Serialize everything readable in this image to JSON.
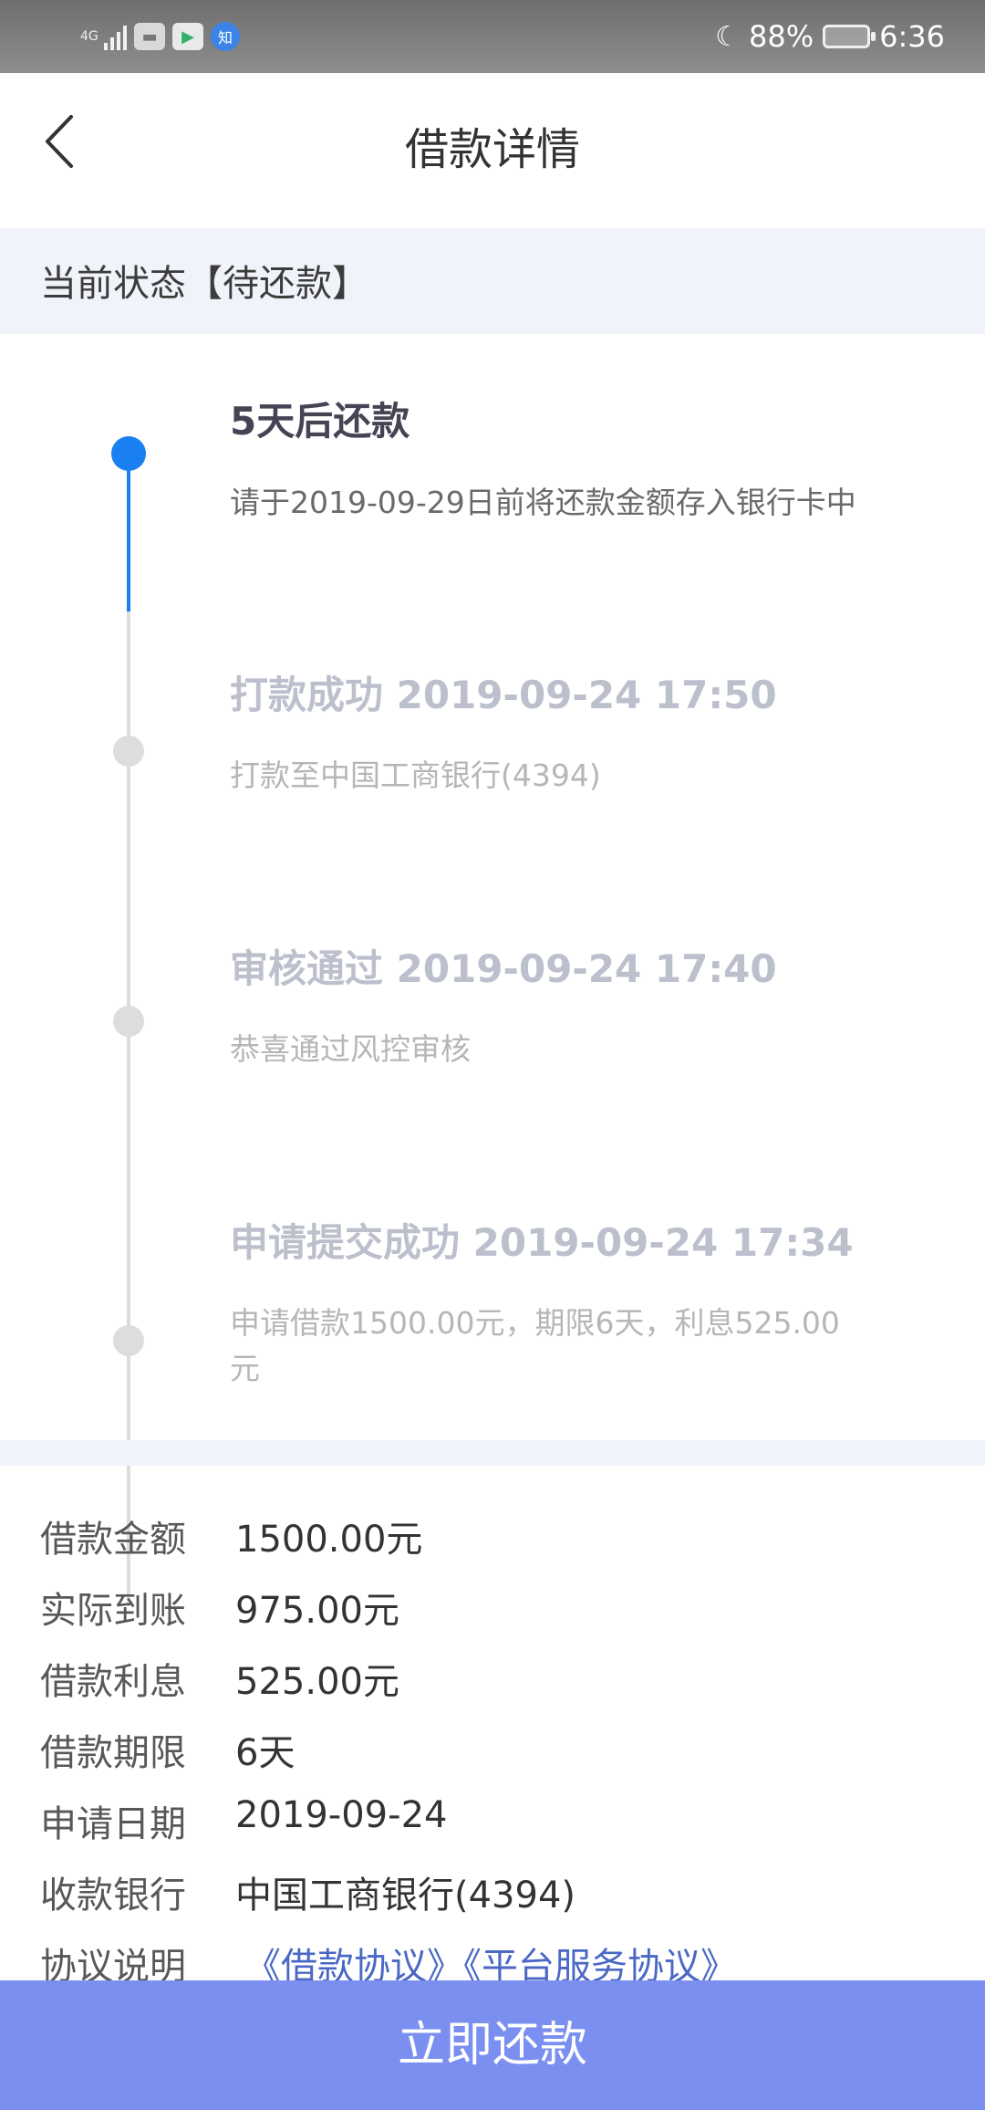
{
  "status_bar": {
    "network": "4G",
    "battery_pct": "88%",
    "time": "6:36",
    "app_zhi": "知"
  },
  "nav": {
    "title": "借款详情"
  },
  "status": {
    "text": "当前状态【待还款】"
  },
  "timeline": [
    {
      "title": "5天后还款",
      "desc": "请于2019-09-29日前将还款金额存入银行卡中"
    },
    {
      "title": "打款成功 2019-09-24 17:50",
      "desc": "打款至中国工商银行(4394)"
    },
    {
      "title": "审核通过 2019-09-24 17:40",
      "desc": "恭喜通过风控审核"
    },
    {
      "title": "申请提交成功 2019-09-24 17:34",
      "desc": "申请借款1500.00元，期限6天，利息525.00元"
    }
  ],
  "details": [
    {
      "label": "借款金额",
      "value": "1500.00元"
    },
    {
      "label": "实际到账",
      "value": "975.00元"
    },
    {
      "label": "借款利息",
      "value": "525.00元"
    },
    {
      "label": "借款期限",
      "value": "6天"
    },
    {
      "label": "申请日期",
      "value": "2019-09-24"
    },
    {
      "label": "收款银行",
      "value": "中国工商银行(4394)"
    }
  ],
  "agreement": {
    "label": "协议说明",
    "link1": "《借款协议》",
    "link2": "《平台服务协议》"
  },
  "repay_button": "立即还款",
  "colors": {
    "accent": "#1a7ff0",
    "button": "#7b8ff0",
    "section_bg": "#f1f3fb"
  }
}
